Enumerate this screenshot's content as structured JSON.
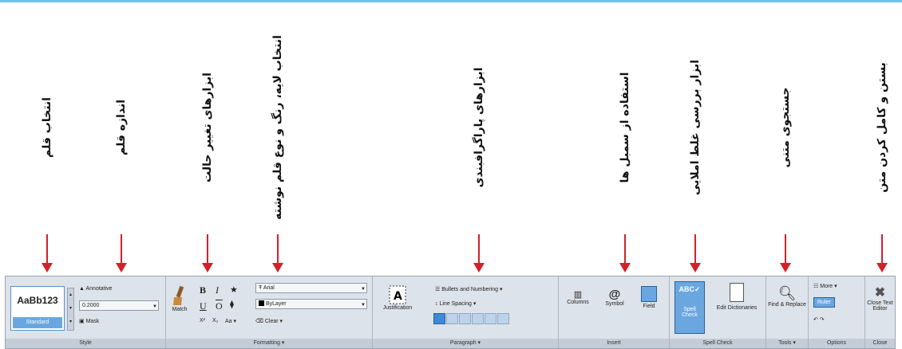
{
  "captions": [
    "انتخاب قلم",
    "اندازه قلم",
    "ابزارهای تغییر حالت",
    "انتخاب لایه، رنگ و نوع قلم نوشته",
    "ابزارهای پاراگرافبندی",
    "استفاده از سمبل ها",
    "ابزار بررسی غلط املایی",
    "جستجوی متنی",
    "بستن و کامل کردن متن"
  ],
  "ribbon": {
    "style": {
      "swatch_text": "AaBb123",
      "swatch_name": "Standard",
      "annotative": "Annotative",
      "height_value": "0.2000",
      "mask": "Mask",
      "panel_label": "Style"
    },
    "formatting": {
      "match": "Match",
      "bold": "B",
      "italic": "I",
      "underline": "U",
      "overline": "O",
      "superscript": "X²",
      "subscript": "X₂",
      "case": "Aa ▾",
      "clear": "Clear ▾",
      "font": "Arial",
      "color": "ByLayer",
      "panel_label": "Formatting ▾"
    },
    "paragraph": {
      "justification": "Justification",
      "bullets": "Bullets and Numbering ▾",
      "line_spacing": "Line Spacing ▾",
      "panel_label": "Paragraph ▾"
    },
    "insert": {
      "columns": "Columns",
      "symbol": "Symbol",
      "field": "Field",
      "panel_label": "Insert"
    },
    "spell": {
      "spell_check": "Spell Check",
      "edit_dictionaries": "Edit Dictionaries",
      "panel_label": "Spell Check"
    },
    "tools": {
      "find_replace": "Find & Replace",
      "panel_label": "Tools ▾"
    },
    "options": {
      "more": "More ▾",
      "ruler": "Ruler",
      "panel_label": "Options"
    },
    "close": {
      "close_editor": "Close Text Editor",
      "panel_label": "Close"
    }
  },
  "colors": {
    "arrow": "#d4202a",
    "ribbon_bg": "#dde3ea",
    "accent_blue": "#3d8ad8"
  }
}
